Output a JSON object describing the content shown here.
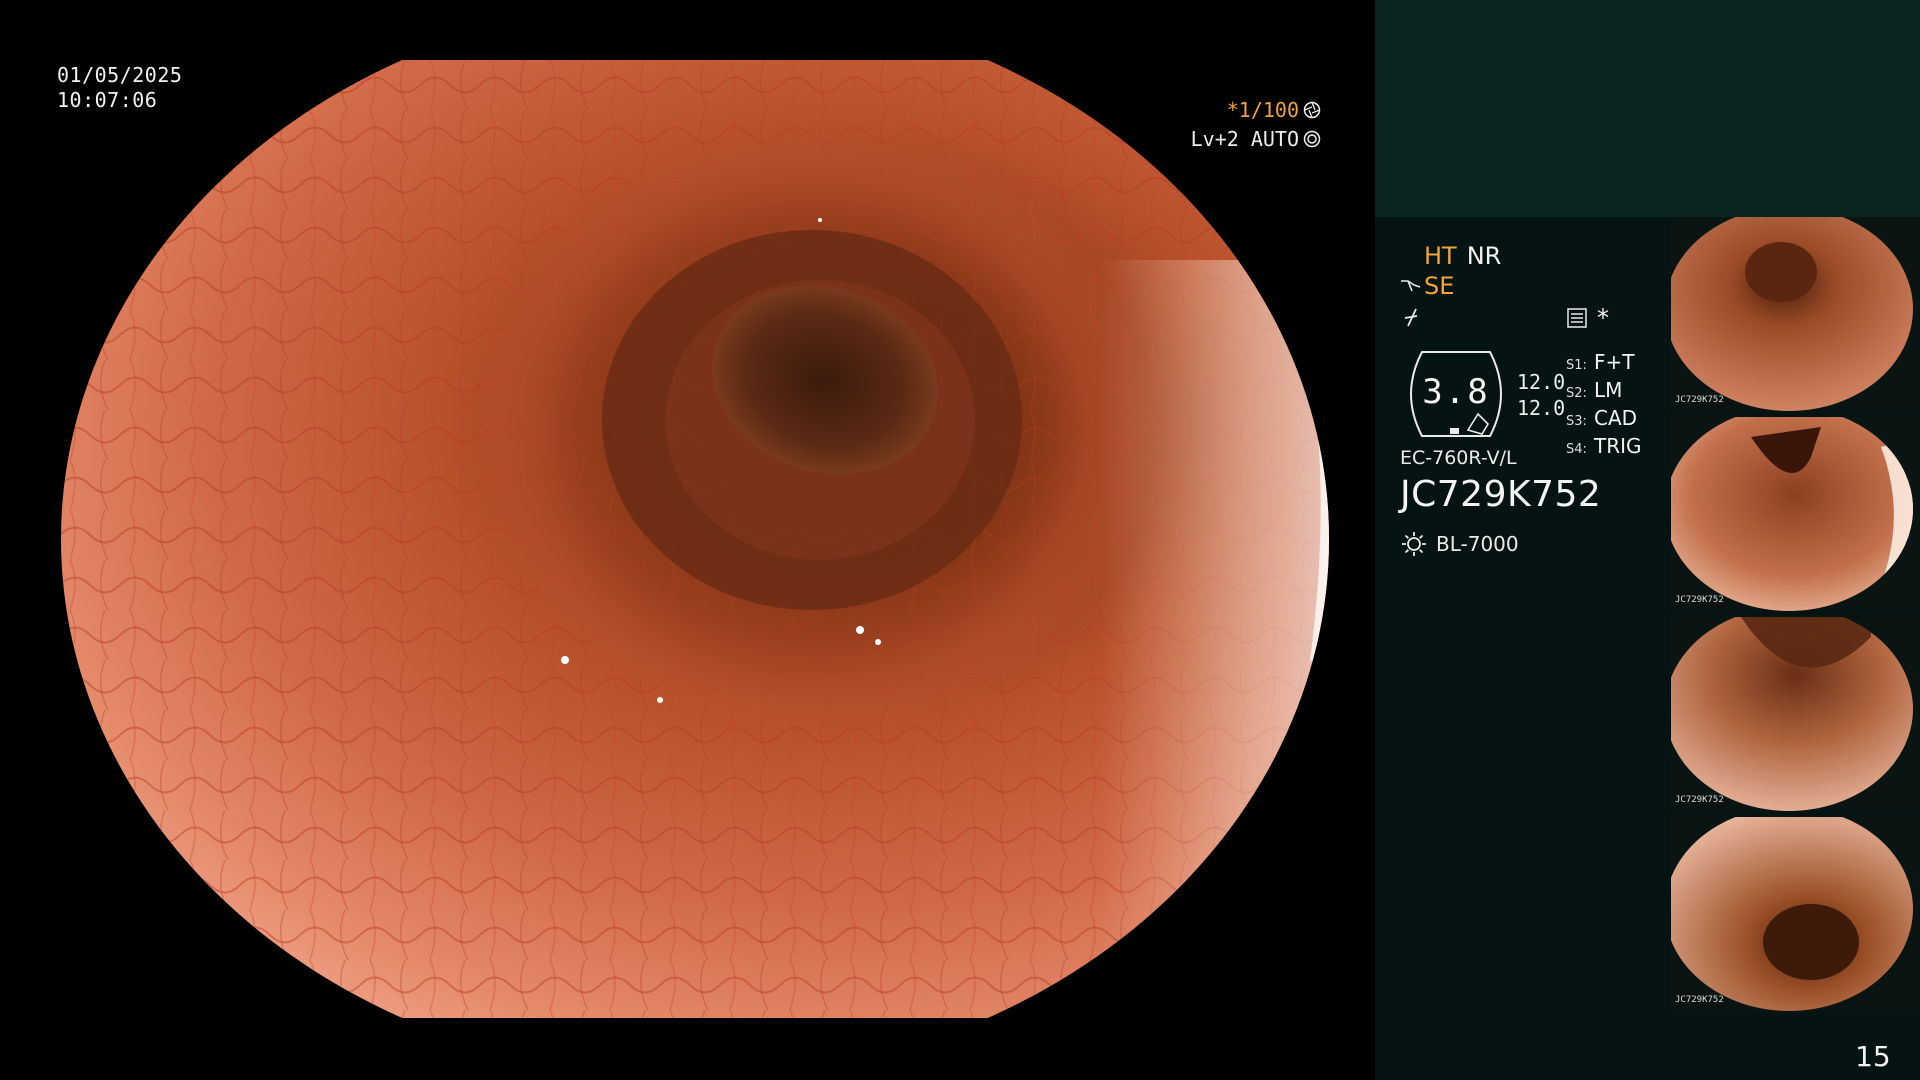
{
  "overlay": {
    "date": "01/05/2025",
    "time": "10:07:06",
    "shutter": "*1/100",
    "level": "Lv+2 AUTO"
  },
  "panel": {
    "ht": "HT",
    "nr": "NR",
    "se": "SE",
    "asterisk": "*",
    "gauge_value": "3.8",
    "gauge_values": [
      "12.0",
      "12.0"
    ],
    "switches": [
      {
        "key": "S1:",
        "value": "F+T"
      },
      {
        "key": "S2:",
        "value": "LM"
      },
      {
        "key": "S3:",
        "value": "CAD"
      },
      {
        "key": "S4:",
        "value": "TRIG"
      }
    ],
    "scope_model": "EC-760R-V/L",
    "scope_serial": "JC729K752",
    "light_source": "BL-7000"
  },
  "thumbnails": [
    {
      "serial": "JC729K752"
    },
    {
      "serial": "JC729K752"
    },
    {
      "serial": "JC729K752"
    },
    {
      "serial": "JC729K752"
    }
  ],
  "page_number": "15",
  "colors": {
    "accent_orange": "#f0a43a",
    "panel_top": "#0b2421",
    "panel_bottom": "#051412",
    "background": "#000000"
  },
  "icons": {
    "shutter": "aperture-icon",
    "level": "ring-icon",
    "se": "scope-tip-icon",
    "freeze": "freeze-icon",
    "menu": "menu-icon",
    "light": "light-source-icon"
  }
}
